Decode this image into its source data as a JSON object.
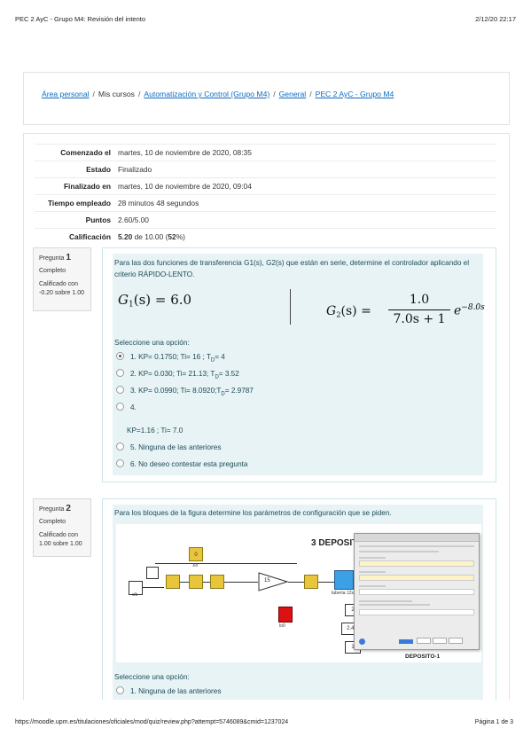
{
  "page": {
    "title": "PEC 2 AyC - Grupo M4: Revisión del intento",
    "date": "2/12/20 22:17",
    "footer_url": "https://moodle.upm.es/titulaciones/oficiales/mod/quiz/review.php?attempt=5746089&cmid=1237024",
    "footer_page": "Página 1 de 3"
  },
  "breadcrumb": {
    "items": [
      "Área personal",
      "Mis cursos",
      "Automatización y Control (Grupo M4)",
      "General",
      "PEC 2 AyC - Grupo M4"
    ],
    "sep": "/"
  },
  "summary": [
    {
      "label": "Comenzado el",
      "value": "martes, 10 de noviembre de 2020, 08:35"
    },
    {
      "label": "Estado",
      "value": "Finalizado"
    },
    {
      "label": "Finalizado en",
      "value": "martes, 10 de noviembre de 2020, 09:04"
    },
    {
      "label": "Tiempo empleado",
      "value": "28 minutos 48 segundos"
    },
    {
      "label": "Puntos",
      "value": "2.60/5.00"
    },
    {
      "label": "Calificación",
      "grade_bold": "5.20",
      "grade_mid": " de 10.00 (",
      "grade_pct": "52",
      "grade_end": "%)"
    }
  ],
  "q1": {
    "label": "Pregunta",
    "num": "1",
    "state": "Completo",
    "mark": "Calificado con -0.20 sobre 1.00",
    "text": "Para las dos funciones de transferencia G1(s), G2(s) que están en serie, determine el controlador aplicando el criterio RÁPIDO-LENTO.",
    "g1_left": "G",
    "g1_sub": "1",
    "g1_right": "(s) = 6.0",
    "g2_left": "G",
    "g2_sub": "2",
    "g2_mid": "(s) =",
    "g2_num": "1.0",
    "g2_den": "7.0s + 1",
    "g2_exp_base": "e",
    "g2_exp": "−8.0s",
    "prompt": "Seleccione una opción:",
    "options": [
      {
        "pre": "1. KP=  0.1750; Ti= 16  ; T",
        "sub": "D",
        "post": "= 4",
        "checked": true
      },
      {
        "pre": "2. KP=  0.030; Ti= 21.13; T",
        "sub": "D",
        "post": "= 3.52",
        "checked": false
      },
      {
        "pre": "3. KP=  0.0990; Ti= 8.0920;T",
        "sub": "D",
        "post": "= 2.9787",
        "checked": false
      },
      {
        "pre": "4.",
        "sub": "",
        "post": "",
        "checked": false
      },
      {
        "pre": "5. Ninguna de las anteriores",
        "sub": "",
        "post": "",
        "checked": false
      },
      {
        "pre": "6. No deseo contestar esta pregunta",
        "sub": "",
        "post": "",
        "checked": false
      }
    ],
    "opt4_detail": "KP=1.16  ; Ti= 7.0"
  },
  "q2": {
    "label": "Pregunta",
    "num": "2",
    "state": "Completo",
    "mark": "Calificado con 1.00 sobre 1.00",
    "text": "Para los bloques de la figura determine los parámetros de configuración que se piden.",
    "diagram": {
      "title": "3 DEPOSITO",
      "block_xo": "Xo",
      "block_15": "15",
      "block_tuberia": "tubería 12s",
      "block_lo0": "lo0",
      "block_clk": "clk",
      "const_2": "2",
      "const_248": "2.48",
      "const_1": "1",
      "deposito": "DEPOSITO-1",
      "block_0": "0"
    },
    "prompt": "Seleccione una opción:",
    "options": [
      {
        "label": "1. Ninguna de las anteriores",
        "checked": false
      }
    ]
  }
}
